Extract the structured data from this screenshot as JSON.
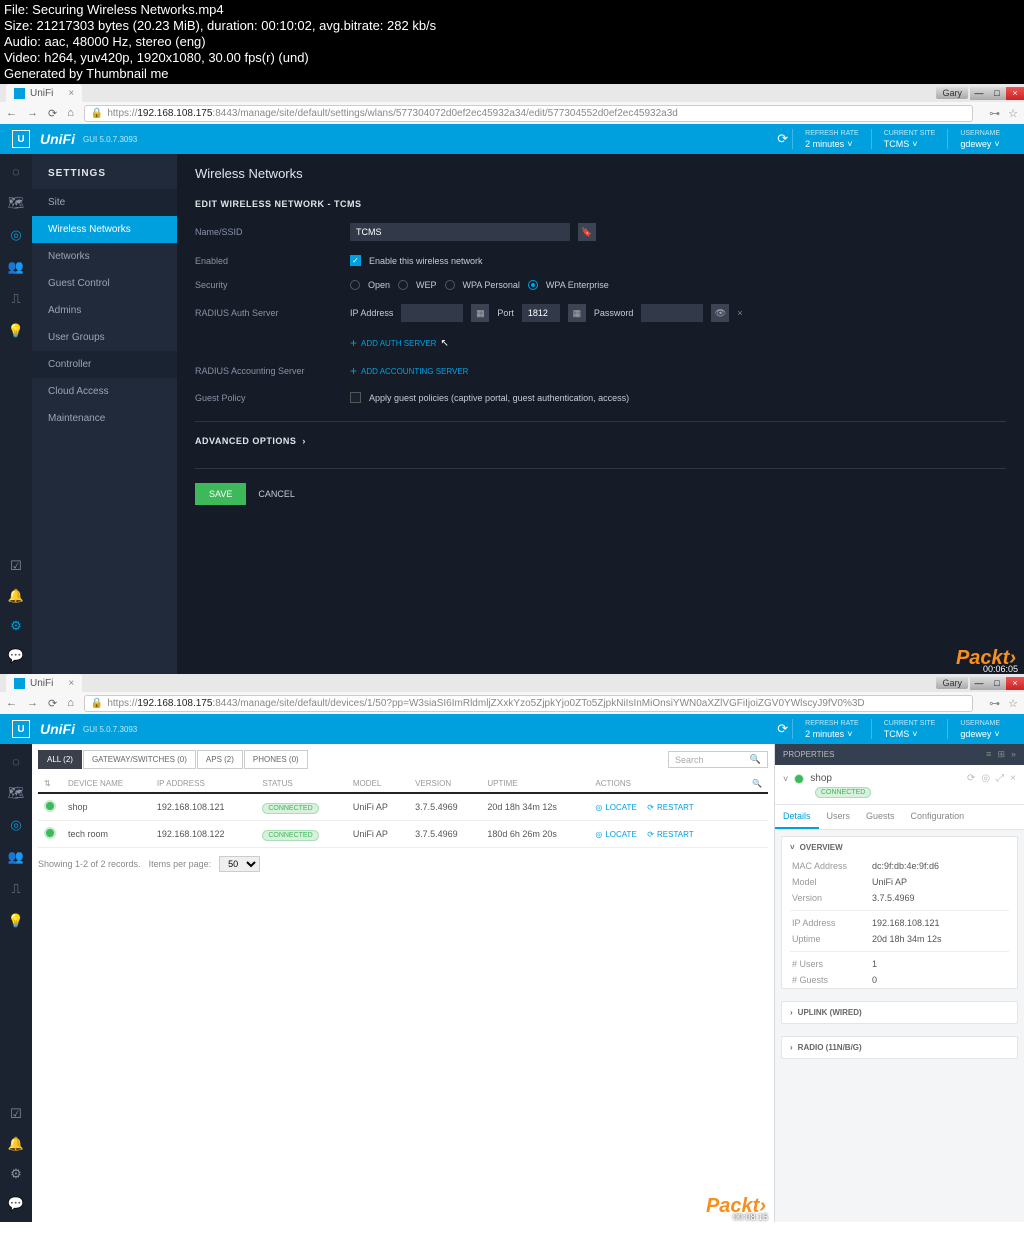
{
  "fileinfo": {
    "l1": "File: Securing Wireless Networks.mp4",
    "l2": "Size: 21217303 bytes (20.23 MiB), duration: 00:10:02, avg.bitrate: 282 kb/s",
    "l3": "Audio: aac, 48000 Hz, stereo (eng)",
    "l4": "Video: h264, yuv420p, 1920x1080, 30.00 fps(r) (und)",
    "l5": "Generated by Thumbnail me"
  },
  "tab_title": "UniFi",
  "win_user": "Gary",
  "url1_prefix": "https://",
  "url1_ip": "192.168.108.175",
  "url1_rest": ":8443/manage/site/default/settings/wlans/577304072d0ef2ec45932a34/edit/577304552d0ef2ec45932a3d",
  "url2_prefix": "https://",
  "url2_ip": "192.168.108.175",
  "url2_rest": ":8443/manage/site/default/devices/1/50?pp=W3siaSI6ImRldmljZXxkYzo5ZjpkYjo0ZTo5ZjpkNiIsInMiOnsiYWN0aXZlVGFiIjoiZGV0YWlscyJ9fV0%3D",
  "hdr": {
    "logo": "UniFi",
    "gui": "GUI 5.0.7.3093",
    "refresh_lbl": "REFRESH RATE",
    "refresh_val": "2 minutes",
    "site_lbl": "CURRENT SITE",
    "site_val": "TCMS",
    "user_lbl": "USERNAME",
    "user_val": "gdewey"
  },
  "settings": {
    "title": "SETTINGS",
    "items": [
      "Site",
      "Wireless Networks",
      "Networks",
      "Guest Control",
      "Admins",
      "User Groups",
      "Controller",
      "Cloud Access",
      "Maintenance"
    ]
  },
  "wlan": {
    "page_title": "Wireless Networks",
    "section": "EDIT WIRELESS NETWORK - TCMS",
    "labels": {
      "ssid": "Name/SSID",
      "enabled": "Enabled",
      "security": "Security",
      "radius_auth": "RADIUS Auth Server",
      "radius_acct": "RADIUS Accounting Server",
      "guest": "Guest Policy"
    },
    "ssid_val": "TCMS",
    "enabled_text": "Enable this wireless network",
    "sec": {
      "open": "Open",
      "wep": "WEP",
      "wpap": "WPA Personal",
      "wpae": "WPA Enterprise"
    },
    "ip_lbl": "IP Address",
    "port_lbl": "Port",
    "port_val": "1812",
    "pwd_lbl": "Password",
    "add_auth": "ADD AUTH SERVER",
    "add_acct": "ADD ACCOUNTING SERVER",
    "guest_text": "Apply guest policies (captive portal, guest authentication, access)",
    "advanced": "ADVANCED OPTIONS",
    "save": "SAVE",
    "cancel": "CANCEL"
  },
  "ts1": "00:06:05",
  "ts2": "00:08:15",
  "watermark": "Packt›",
  "dev": {
    "filters": {
      "all": "ALL (2)",
      "gw": "GATEWAY/SWITCHES (0)",
      "aps": "APS (2)",
      "phones": "PHONES (0)"
    },
    "search": "Search",
    "cols": {
      "name": "DEVICE NAME",
      "ip": "IP ADDRESS",
      "status": "STATUS",
      "model": "MODEL",
      "version": "VERSION",
      "uptime": "UPTIME",
      "actions": "ACTIONS"
    },
    "connected": "CONNECTED",
    "locate": "LOCATE",
    "restart": "RESTART",
    "rows": [
      {
        "name": "shop",
        "ip": "192.168.108.121",
        "model": "UniFi AP",
        "ver": "3.7.5.4969",
        "up": "20d 18h 34m 12s"
      },
      {
        "name": "tech room",
        "ip": "192.168.108.122",
        "model": "UniFi AP",
        "ver": "3.7.5.4969",
        "up": "180d 6h 26m 20s"
      }
    ],
    "pager_txt": "Showing 1-2 of 2 records.",
    "ipp": "Items per page:",
    "ipp_val": "50"
  },
  "prop": {
    "title": "PROPERTIES",
    "dev_name": "shop",
    "conn": "CONNECTED",
    "tabs": {
      "details": "Details",
      "users": "Users",
      "guests": "Guests",
      "config": "Configuration"
    },
    "overview": "OVERVIEW",
    "kv": {
      "mac_k": "MAC Address",
      "mac_v": "dc:9f:db:4e:9f:d6",
      "model_k": "Model",
      "model_v": "UniFi AP",
      "ver_k": "Version",
      "ver_v": "3.7.5.4969",
      "ip_k": "IP Address",
      "ip_v": "192.168.108.121",
      "up_k": "Uptime",
      "up_v": "20d 18h 34m 12s",
      "users_k": "# Users",
      "users_v": "1",
      "guests_k": "# Guests",
      "guests_v": "0"
    },
    "uplink": "UPLINK (WIRED)",
    "radio": "RADIO (11N/B/G)"
  }
}
